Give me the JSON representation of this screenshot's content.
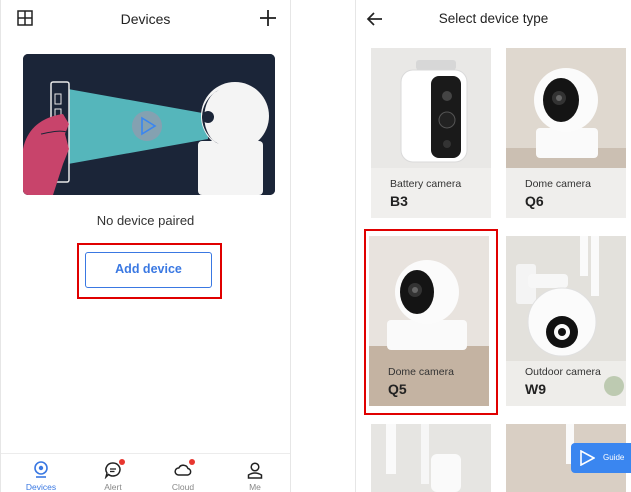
{
  "left_screen": {
    "header": {
      "title": "Devices",
      "left_icon": "grid-icon",
      "right_icon": "plus-icon"
    },
    "empty_state": {
      "message": "No device paired"
    },
    "add_device_label": "Add device",
    "tabbar": [
      {
        "label": "Devices",
        "icon": "camera-icon",
        "active": true,
        "badge": false
      },
      {
        "label": "Alert",
        "icon": "message-icon",
        "active": false,
        "badge": true
      },
      {
        "label": "Cloud",
        "icon": "cloud-icon",
        "active": false,
        "badge": true
      },
      {
        "label": "Me",
        "icon": "person-icon",
        "active": false,
        "badge": false
      }
    ]
  },
  "right_screen": {
    "header": {
      "title": "Select device type",
      "back_icon": "back-arrow-icon"
    },
    "devices": [
      {
        "type": "Battery camera",
        "model": "B3"
      },
      {
        "type": "Dome camera",
        "model": "Q6"
      },
      {
        "type": "Dome camera",
        "model": "Q5",
        "highlighted": true
      },
      {
        "type": "Outdoor camera",
        "model": "W9"
      }
    ],
    "guide_label": "Guide"
  },
  "colors": {
    "accent": "#3a78e2",
    "highlight": "#e00000",
    "badge": "#e8362f",
    "hero_bg": "#1b2538"
  }
}
